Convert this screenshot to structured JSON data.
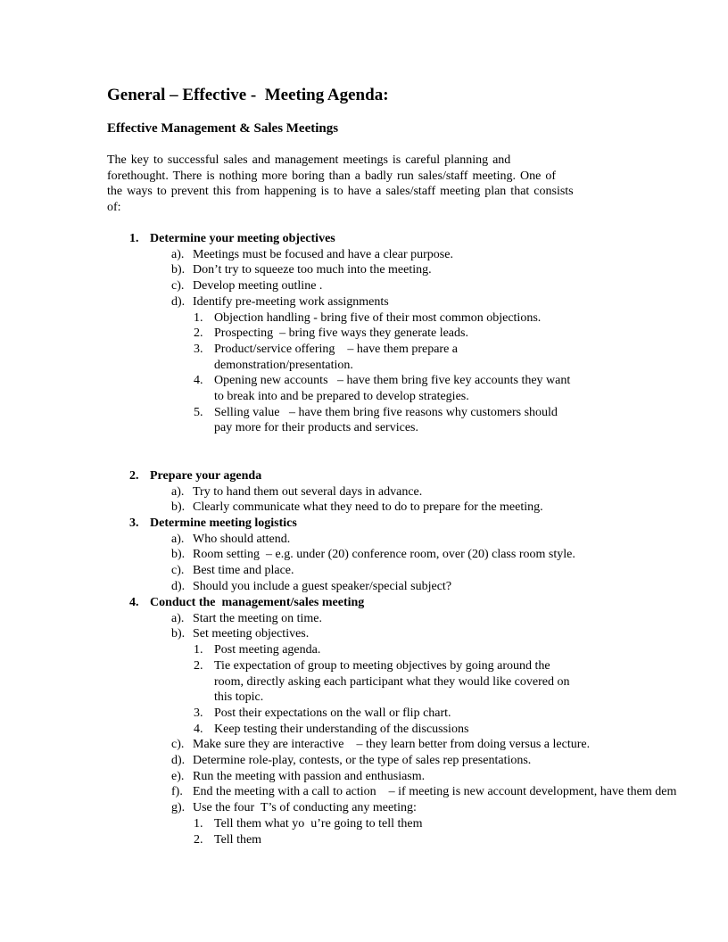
{
  "title": "General – Effective -  Meeting Agenda:",
  "subtitle": "Effective Management & Sales Meetings",
  "intro": [
    "The key to successful sales and management meetings is careful planning and",
    "forethought.   There is nothing more boring than a badly run sales/staff meeting.   One of",
    "the ways to prevent this from happening is to have a sales/staff meeting plan that consists",
    "of:"
  ],
  "sections": [
    {
      "number": "1.",
      "heading": "Determine your meeting objectives",
      "items": [
        {
          "label": "a).",
          "text": "Meetings must be focused and have a clear purpose."
        },
        {
          "label": "b).",
          "text": "Don’t try to squeeze too much into the meeting."
        },
        {
          "label": "c).",
          "text": "Develop meeting outline ."
        },
        {
          "label": "d).",
          "text": "Identify pre-meeting work assignments",
          "subitems": [
            {
              "label": "1.",
              "lines": [
                "Objection handling - bring five of their most common objections."
              ]
            },
            {
              "label": "2.",
              "lines": [
                "Prospecting  – bring five ways they generate leads."
              ]
            },
            {
              "label": "3.",
              "lines": [
                "Product/service offering    – have them prepare a",
                "demonstration/presentation."
              ]
            },
            {
              "label": "4.",
              "lines": [
                "Opening new accounts   – have them bring five key accounts they want",
                "to break into and be prepared to develop strategies."
              ]
            },
            {
              "label": "5.",
              "lines": [
                "Selling value   – have them bring five reasons why customers should",
                "pay more for their products and services."
              ]
            }
          ]
        }
      ]
    },
    {
      "number": "2.",
      "heading": "Prepare your agenda",
      "items": [
        {
          "label": "a).",
          "text": "Try to hand them out several days in advance."
        },
        {
          "label": "b).",
          "text": "Clearly communicate what they need to do to prepare for the meeting."
        }
      ]
    },
    {
      "number": "3.",
      "heading": "Determine meeting logistics",
      "items": [
        {
          "label": "a).",
          "text": "Who should attend."
        },
        {
          "label": "b).",
          "text": "Room setting  – e.g. under (20) conference room, over (20) class room style."
        },
        {
          "label": "c).",
          "text": "Best time and place."
        },
        {
          "label": "d).",
          "text": "Should you include a guest speaker/special subject?"
        }
      ]
    },
    {
      "number": "4.",
      "heading": "Conduct the  management/sales meeting",
      "items": [
        {
          "label": "a).",
          "text": "Start the meeting on time."
        },
        {
          "label": "b).",
          "text": "Set meeting objectives.",
          "subitems": [
            {
              "label": "1.",
              "lines": [
                "Post meeting agenda."
              ]
            },
            {
              "label": "2.",
              "lines": [
                "Tie expectation of group to meeting objectives by going around the",
                "room, directly asking each participant what they would like covered on",
                "this topic."
              ]
            },
            {
              "label": "3.",
              "lines": [
                "Post their expectations on the wall or flip chart."
              ]
            },
            {
              "label": "4.",
              "lines": [
                "Keep testing their understanding of the discussions"
              ]
            }
          ]
        },
        {
          "label": "c).",
          "text": "Make sure they are interactive    – they learn better from doing versus a lecture."
        },
        {
          "label": "d).",
          "text": "Determine role-play, contests, or the type of sales rep presentations."
        },
        {
          "label": "e).",
          "text": "Run the meeting with passion and enthusiasm."
        },
        {
          "label": "f).",
          "text": "End the meeting with a call to action    – if meeting is new account development, have them dem"
        },
        {
          "label": "g).",
          "text": "Use the four  T’s of conducting any meeting:",
          "subitems": [
            {
              "label": "1.",
              "lines": [
                "Tell them what yo  u’re going to tell them"
              ]
            },
            {
              "label": "2.",
              "lines": [
                "Tell them"
              ]
            }
          ]
        }
      ]
    }
  ]
}
